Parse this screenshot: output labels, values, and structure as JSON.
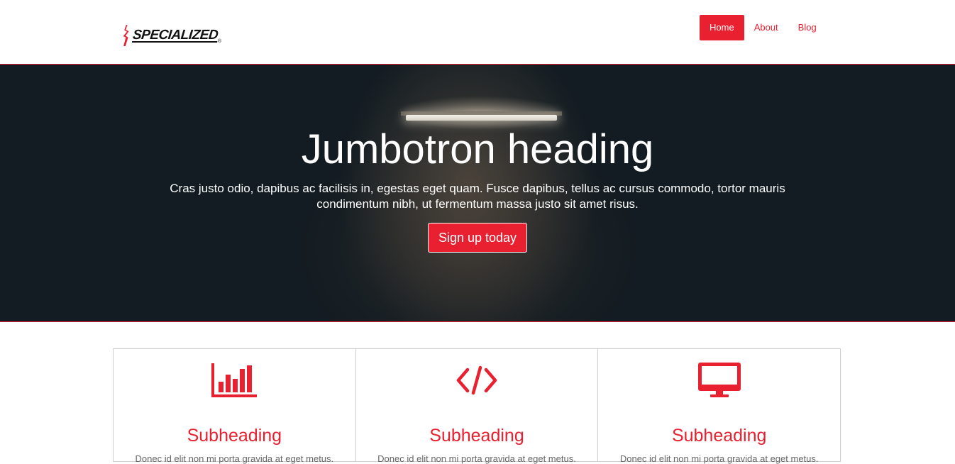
{
  "brand": {
    "name": "SPECIALIZED",
    "accent": "#e8202f"
  },
  "nav": {
    "items": [
      {
        "label": "Home",
        "active": true
      },
      {
        "label": "About",
        "active": false
      },
      {
        "label": "Blog",
        "active": false
      }
    ]
  },
  "jumbotron": {
    "heading": "Jumbotron heading",
    "lead": "Cras justo odio, dapibus ac facilisis in, egestas eget quam. Fusce dapibus, tellus ac cursus commodo, tortor mauris condimentum nibh, ut fermentum massa justo sit amet risus.",
    "cta_label": "Sign up today"
  },
  "features": [
    {
      "icon": "bar-chart-icon",
      "title": "Subheading",
      "text": "Donec id elit non mi porta gravida at eget metus."
    },
    {
      "icon": "code-icon",
      "title": "Subheading",
      "text": "Donec id elit non mi porta gravida at eget metus."
    },
    {
      "icon": "desktop-monitor-icon",
      "title": "Subheading",
      "text": "Donec id elit non mi porta gravida at eget metus."
    }
  ]
}
